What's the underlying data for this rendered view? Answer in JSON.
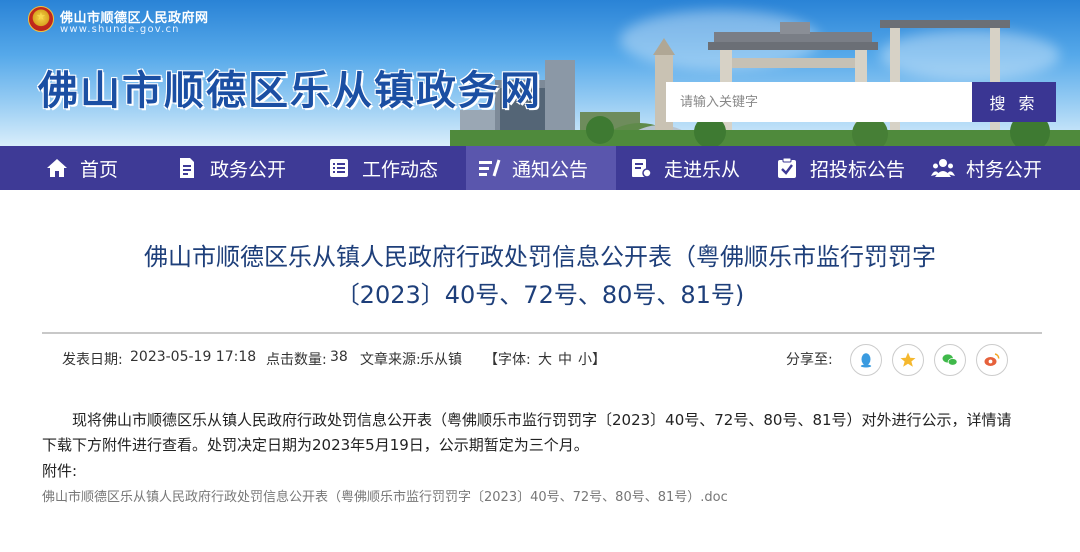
{
  "header": {
    "site_name_small": "佛山市顺德区人民政府网",
    "site_url": "www.shunde.gov.cn",
    "site_title": "佛山市顺德区乐从镇政务网",
    "search_placeholder": "请输入关键字",
    "search_button": "搜 索"
  },
  "nav": {
    "items": [
      {
        "label": "首页",
        "icon": "home-icon"
      },
      {
        "label": "政务公开",
        "icon": "document-icon"
      },
      {
        "label": "工作动态",
        "icon": "list-icon"
      },
      {
        "label": "通知公告",
        "icon": "notice-icon"
      },
      {
        "label": "走进乐从",
        "icon": "guide-icon"
      },
      {
        "label": "招投标公告",
        "icon": "checklist-icon"
      },
      {
        "label": "村务公开",
        "icon": "people-icon"
      }
    ],
    "active": "通知公告",
    "colors": {
      "bar": "#3e3a96",
      "active": "#5a56ad"
    }
  },
  "article": {
    "title_line1": "佛山市顺德区乐从镇人民政府行政处罚信息公开表（粤佛顺乐市监行罚罚字",
    "title_line2": "〔2023〕40号、72号、80号、81号)",
    "meta": {
      "publish_label": "发表日期:",
      "publish_date": "2023-05-19 17:18",
      "clicks_label": "点击数量:",
      "clicks": "38",
      "source_label": "文章来源:",
      "source": "乐从镇",
      "font_prefix": "【字体:",
      "font_large": "大",
      "font_medium": "中",
      "font_small": "小",
      "font_suffix": "】"
    },
    "share_label": "分享至:",
    "share_icons": [
      "qq-icon",
      "qzone-star-icon",
      "wechat-icon",
      "weibo-icon"
    ],
    "body_line1": "现将佛山市顺德区乐从镇人民政府行政处罚信息公开表（粤佛顺乐市监行罚罚字〔2023〕40号、72号、80号、81号）对外进行公示，详情请",
    "body_line2": "下载下方附件进行查看。处罚决定日期为2023年5月19日，公示期暂定为三个月。",
    "attachment_label": "附件:",
    "attachment_link": "佛山市顺德区乐从镇人民政府行政处罚信息公开表（粤佛顺乐市监行罚罚字〔2023〕40号、72号、80号、81号）.doc"
  }
}
